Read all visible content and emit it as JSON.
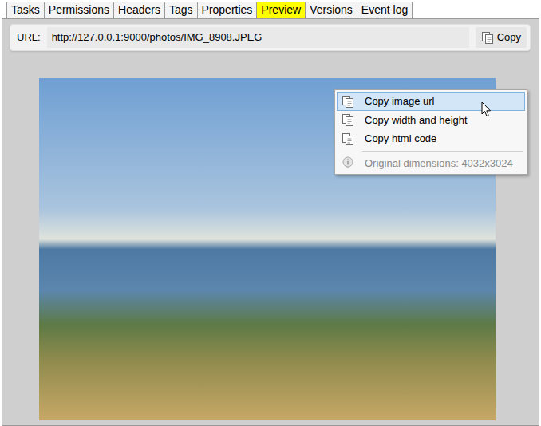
{
  "tabs": [
    {
      "label": "Tasks",
      "selected": false
    },
    {
      "label": "Permissions",
      "selected": false
    },
    {
      "label": "Headers",
      "selected": false
    },
    {
      "label": "Tags",
      "selected": false
    },
    {
      "label": "Properties",
      "selected": false
    },
    {
      "label": "Preview",
      "selected": true
    },
    {
      "label": "Versions",
      "selected": false
    },
    {
      "label": "Event log",
      "selected": false
    }
  ],
  "url_bar": {
    "label": "URL:",
    "value": "http://127.0.0.1:9000/photos/IMG_8908.JPEG",
    "copy_button": "Copy"
  },
  "context_menu": {
    "items": [
      {
        "label": "Copy image url",
        "kind": "action",
        "selected": true,
        "disabled": false
      },
      {
        "label": "Copy width and height",
        "kind": "action",
        "selected": false,
        "disabled": false
      },
      {
        "label": "Copy html code",
        "kind": "action",
        "selected": false,
        "disabled": false
      },
      {
        "label": "Original dimensions: 4032x3024",
        "kind": "info",
        "selected": false,
        "disabled": true
      }
    ]
  }
}
